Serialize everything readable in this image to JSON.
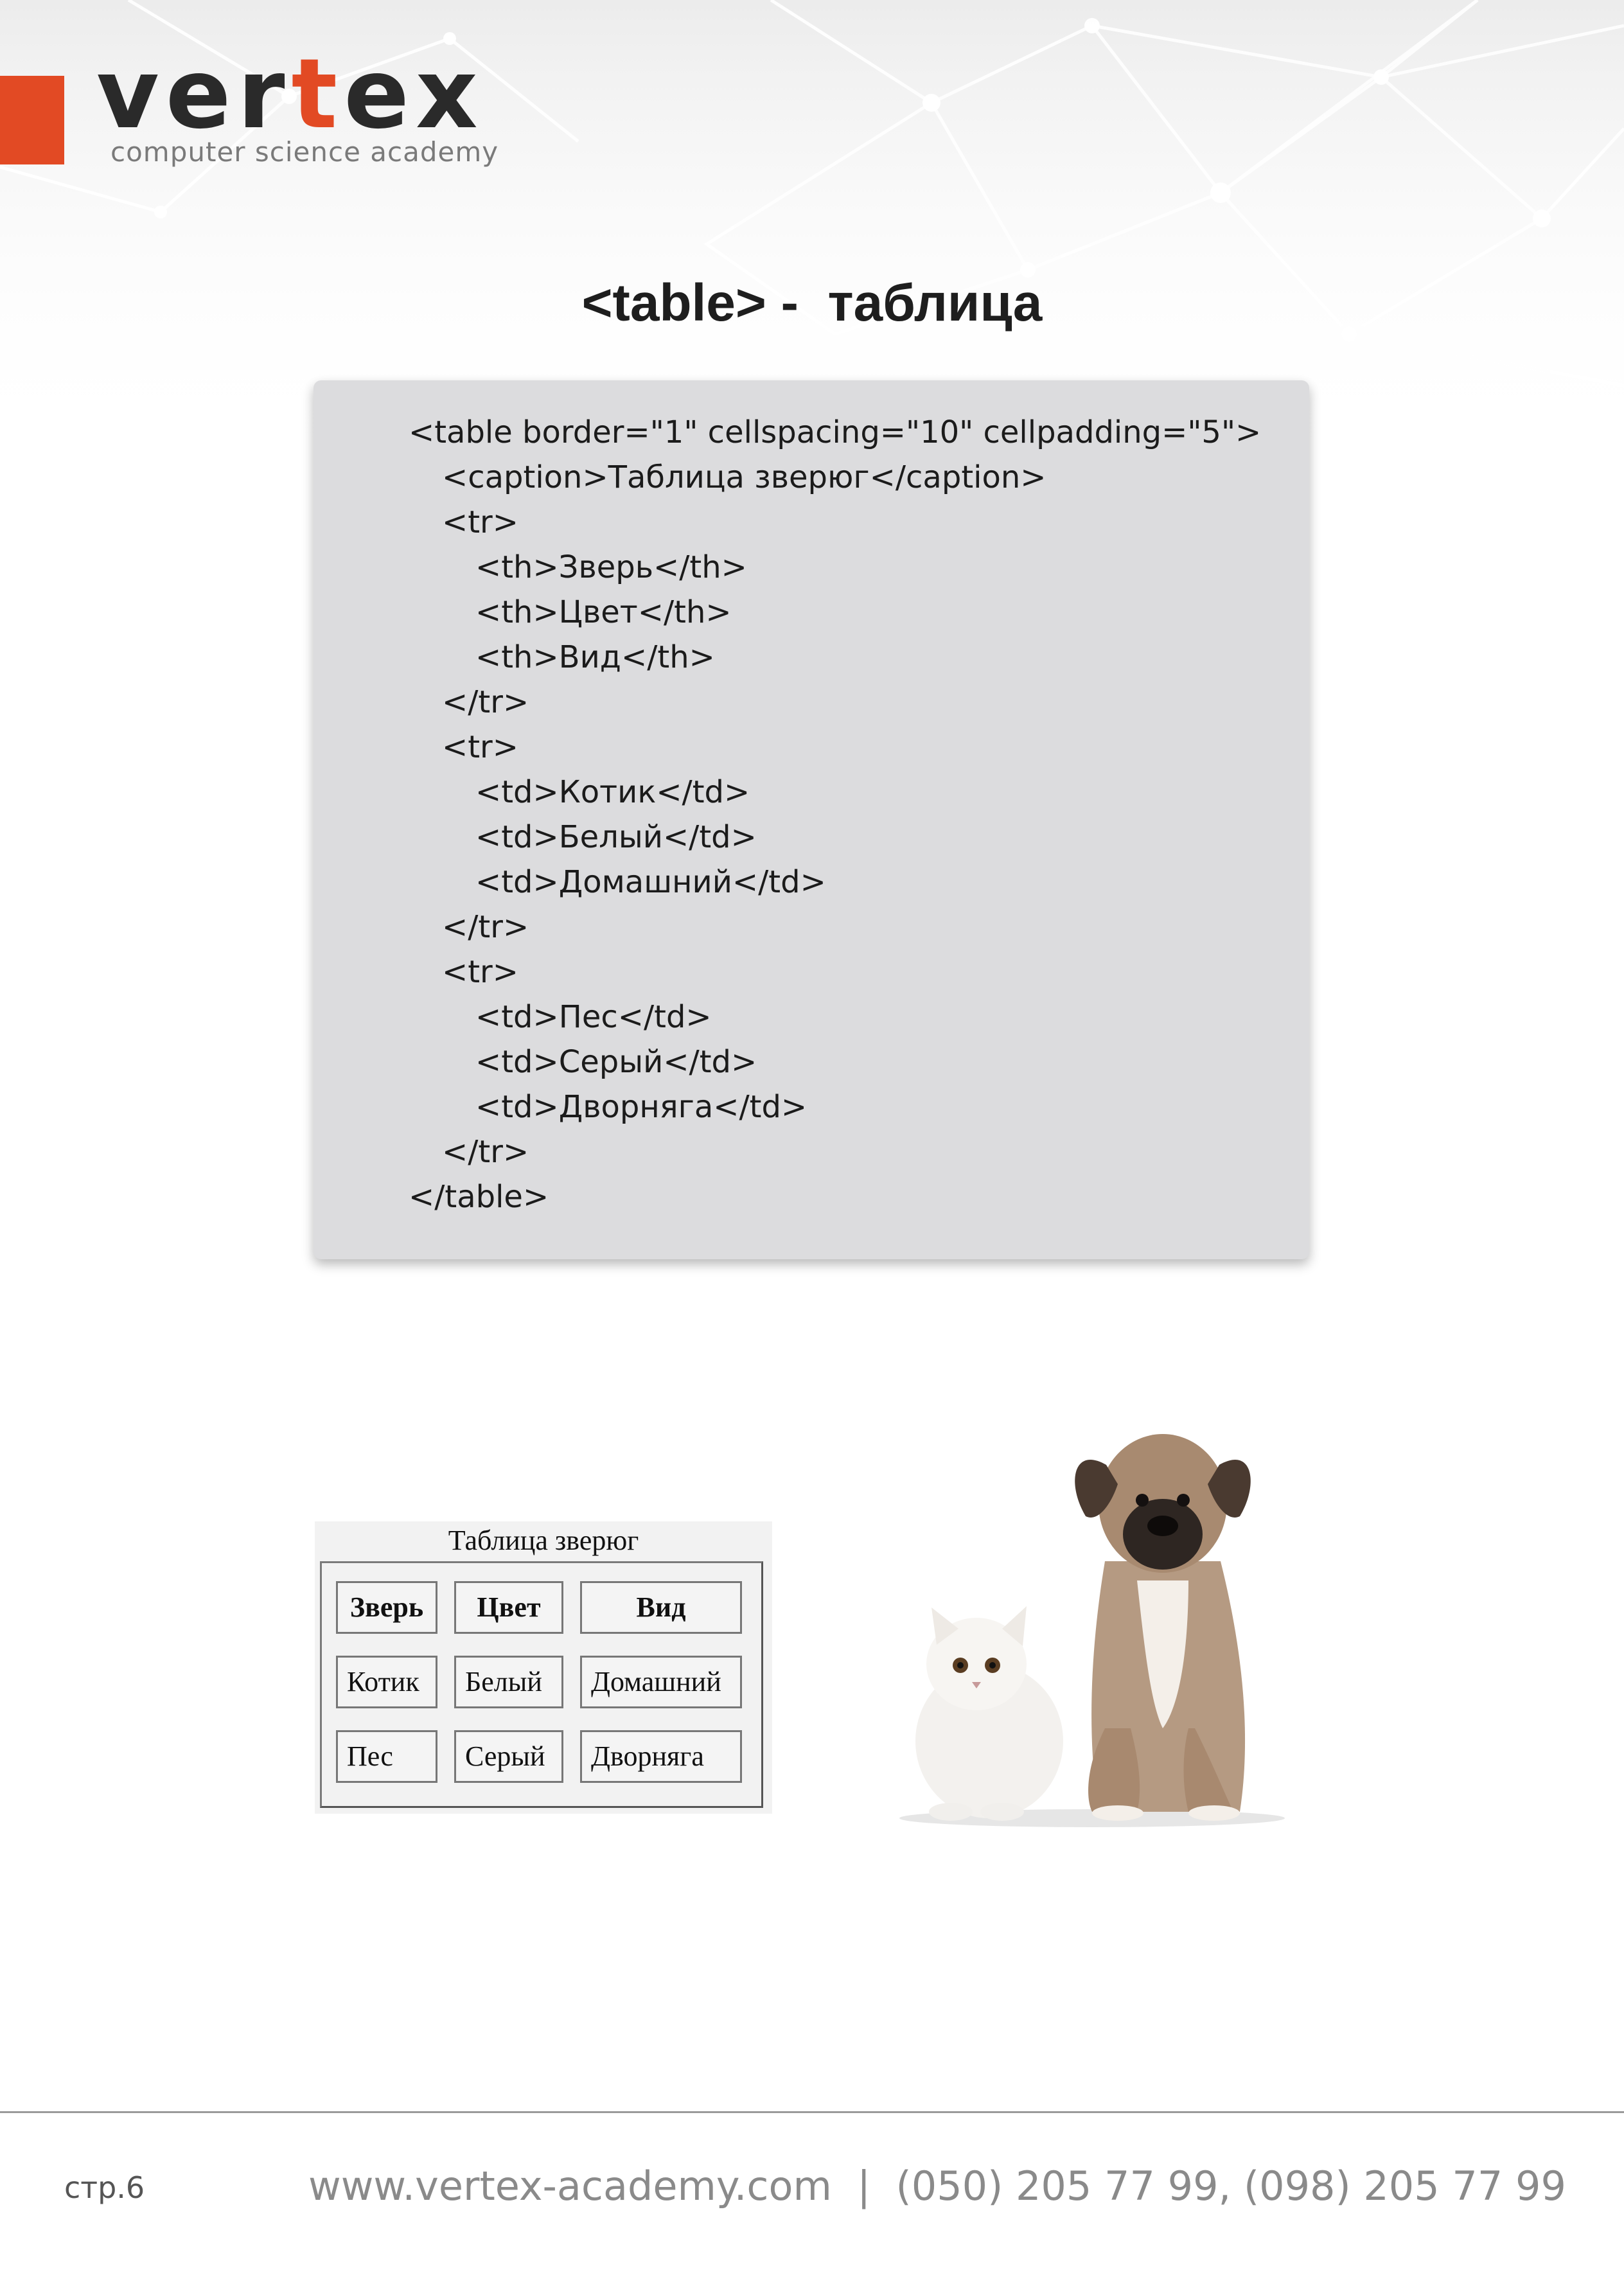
{
  "logo": {
    "word_a": "ver",
    "word_t": "t",
    "word_b": "ex",
    "subtitle": "computer science academy",
    "accent_color": "#e24a24"
  },
  "title": "<table> -  таблица",
  "code": [
    {
      "indent": 1,
      "text": "<table border=\"1\" cellspacing=\"10\" cellpadding=\"5\">"
    },
    {
      "indent": 2,
      "text": "<caption>Таблица зверюг</caption>"
    },
    {
      "indent": 2,
      "text": "<tr>"
    },
    {
      "indent": 3,
      "text": "<th>Зверь</th>"
    },
    {
      "indent": 3,
      "text": "<th>Цвет</th>"
    },
    {
      "indent": 3,
      "text": "<th>Вид</th>"
    },
    {
      "indent": 2,
      "text": "</tr>"
    },
    {
      "indent": 2,
      "text": "<tr>"
    },
    {
      "indent": 3,
      "text": "<td>Котик</td>"
    },
    {
      "indent": 3,
      "text": "<td>Белый</td>"
    },
    {
      "indent": 3,
      "text": "<td>Домашний</td>"
    },
    {
      "indent": 2,
      "text": "</tr>"
    },
    {
      "indent": 2,
      "text": "<tr>"
    },
    {
      "indent": 3,
      "text": "<td>Пес</td>"
    },
    {
      "indent": 3,
      "text": "<td>Серый</td>"
    },
    {
      "indent": 3,
      "text": "<td>Дворняга</td>"
    },
    {
      "indent": 2,
      "text": "</tr>"
    },
    {
      "indent": 1,
      "text": "</table>"
    }
  ],
  "rendered_table": {
    "caption": "Таблица зверюг",
    "headers": [
      "Зверь",
      "Цвет",
      "Вид"
    ],
    "rows": [
      [
        "Котик",
        "Белый",
        "Домашний"
      ],
      [
        "Пес",
        "Серый",
        "Дворняга"
      ]
    ]
  },
  "footer": {
    "page": "стр.6",
    "contact": "www.vertex-academy.com  |  (050) 205 77 99, (098) 205 77 99"
  }
}
